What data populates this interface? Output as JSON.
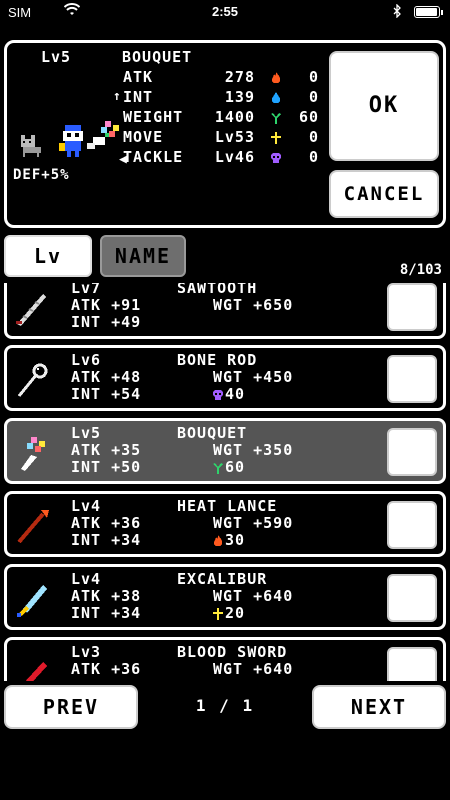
{
  "status_bar": {
    "carrier": "SIM",
    "time": "2:55",
    "battery_level": 0.95
  },
  "selected_panel": {
    "level": "Lv5",
    "name": "BOUQUET",
    "def_bonus": "DEF+5%",
    "stats": [
      {
        "label": "ATK",
        "value": "278",
        "element_icon": "fire-icon",
        "element_color": "#ff5a1f",
        "element_value": "0",
        "prefix": ""
      },
      {
        "label": "INT",
        "value": "139",
        "element_icon": "water-drop-icon",
        "element_color": "#1fa3ff",
        "element_value": "0",
        "prefix": "↑"
      },
      {
        "label": "WEIGHT",
        "value": "1400",
        "element_icon": "plant-icon",
        "element_color": "#2ed36b",
        "element_value": "60",
        "prefix": ""
      },
      {
        "label": "MOVE",
        "value": "Lv53",
        "element_icon": "light-cross-icon",
        "element_color": "#ffe93b",
        "element_value": "0",
        "prefix": ""
      },
      {
        "label": "TACKLE",
        "value": "Lv46",
        "element_icon": "skull-icon",
        "element_color": "#a05cff",
        "element_value": "0",
        "prefix": ""
      }
    ],
    "ok_label": "OK",
    "cancel_label": "CANCEL"
  },
  "sort": {
    "lv_label": "Lv",
    "name_label": "NAME"
  },
  "count": "8/103",
  "items": [
    {
      "level": "Lv7",
      "name": "SAWTOOTH",
      "atk": "ATK +91",
      "wgt": "WGT +650",
      "int": "INT +49",
      "bonus_icon": "",
      "bonus_value": "",
      "bonus_color": "",
      "icon": "sawtooth-sword-icon",
      "selected": false
    },
    {
      "level": "Lv6",
      "name": "BONE ROD",
      "atk": "ATK +48",
      "wgt": "WGT +450",
      "int": "INT +54",
      "bonus_icon": "skull-icon",
      "bonus_value": "40",
      "bonus_color": "#a05cff",
      "icon": "bone-rod-icon",
      "selected": false
    },
    {
      "level": "Lv5",
      "name": "BOUQUET",
      "atk": "ATK +35",
      "wgt": "WGT +350",
      "int": "INT +50",
      "bonus_icon": "plant-icon",
      "bonus_value": "60",
      "bonus_color": "#2ed36b",
      "icon": "bouquet-icon",
      "selected": true
    },
    {
      "level": "Lv4",
      "name": "HEAT LANCE",
      "atk": "ATK +36",
      "wgt": "WGT +590",
      "int": "INT +34",
      "bonus_icon": "fire-icon",
      "bonus_value": "30",
      "bonus_color": "#ff5a1f",
      "icon": "heat-lance-icon",
      "selected": false
    },
    {
      "level": "Lv4",
      "name": "EXCALIBUR",
      "atk": "ATK +38",
      "wgt": "WGT +640",
      "int": "INT +34",
      "bonus_icon": "light-cross-icon",
      "bonus_value": "20",
      "bonus_color": "#ffe93b",
      "icon": "excalibur-icon",
      "selected": false
    },
    {
      "level": "Lv3",
      "name": "BLOOD SWORD",
      "atk": "ATK +36",
      "wgt": "WGT +640",
      "int": "",
      "bonus_icon": "",
      "bonus_value": "",
      "bonus_color": "",
      "icon": "blood-sword-icon",
      "selected": false
    }
  ],
  "footer": {
    "prev_label": "PREV",
    "next_label": "NEXT",
    "page": "1 / 1"
  }
}
